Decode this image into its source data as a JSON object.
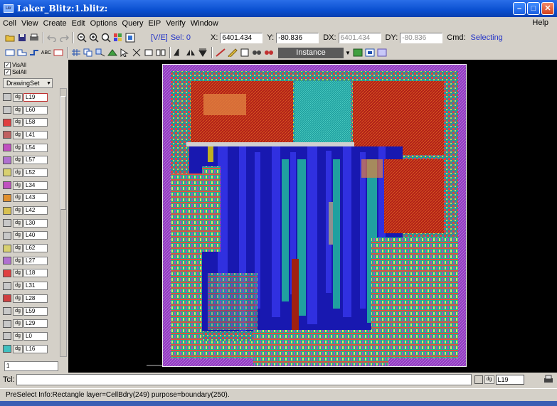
{
  "window": {
    "title": "Laker_Blitz:1.blitz:",
    "app_icon_label": "Lkr"
  },
  "menu": [
    "Cell",
    "View",
    "Create",
    "Edit",
    "Options",
    "Query",
    "EIP",
    "Verify",
    "Window"
  ],
  "menu_help": "Help",
  "toolbar": {
    "ve_label": "[V/E]",
    "sel_label": "Sel: 0",
    "x_label": "X:",
    "x_value": "6401.434",
    "y_label": "Y:",
    "y_value": "-80.836",
    "dx_label": "DX:",
    "dx_value": "6401.434",
    "dy_label": "DY:",
    "dy_value": "-80.836",
    "cmd_label": "Cmd:",
    "cmd_value": "Selecting",
    "instance_label": "Instance"
  },
  "left_panel": {
    "visall_label": "VisAll",
    "selall_label": "SelAll",
    "drawingset_label": "DrawingSet",
    "dg_label": "dg",
    "spin_value": "1",
    "layers": [
      {
        "name": "L19",
        "color": "#c8c8c8"
      },
      {
        "name": "L60",
        "color": "#c8c8c8"
      },
      {
        "name": "L58",
        "color": "#e04040"
      },
      {
        "name": "L41",
        "color": "#c06060"
      },
      {
        "name": "L54",
        "color": "#c050c0"
      },
      {
        "name": "L57",
        "color": "#b070d0"
      },
      {
        "name": "L52",
        "color": "#d8d070"
      },
      {
        "name": "L34",
        "color": "#c050c0"
      },
      {
        "name": "L43",
        "color": "#e09030"
      },
      {
        "name": "L42",
        "color": "#d8c050"
      },
      {
        "name": "L30",
        "color": "#c8c8c8"
      },
      {
        "name": "L40",
        "color": "#c8c8c8"
      },
      {
        "name": "L62",
        "color": "#d8d070"
      },
      {
        "name": "L27",
        "color": "#b070d0"
      },
      {
        "name": "L18",
        "color": "#e04040"
      },
      {
        "name": "L31",
        "color": "#c8c8c8"
      },
      {
        "name": "L28",
        "color": "#d04040"
      },
      {
        "name": "L59",
        "color": "#c8c8c8"
      },
      {
        "name": "L29",
        "color": "#c8c8c8"
      },
      {
        "name": "L0",
        "color": "#c8c8c8"
      },
      {
        "name": "L16",
        "color": "#40c0c0"
      }
    ]
  },
  "tcl": {
    "label": "Tcl:",
    "dg_label": "dg",
    "layer": "L19"
  },
  "status": {
    "text": "PreSelect Info:Rectangle  layer=CellBdry(249) purpose=boundary(250)."
  }
}
